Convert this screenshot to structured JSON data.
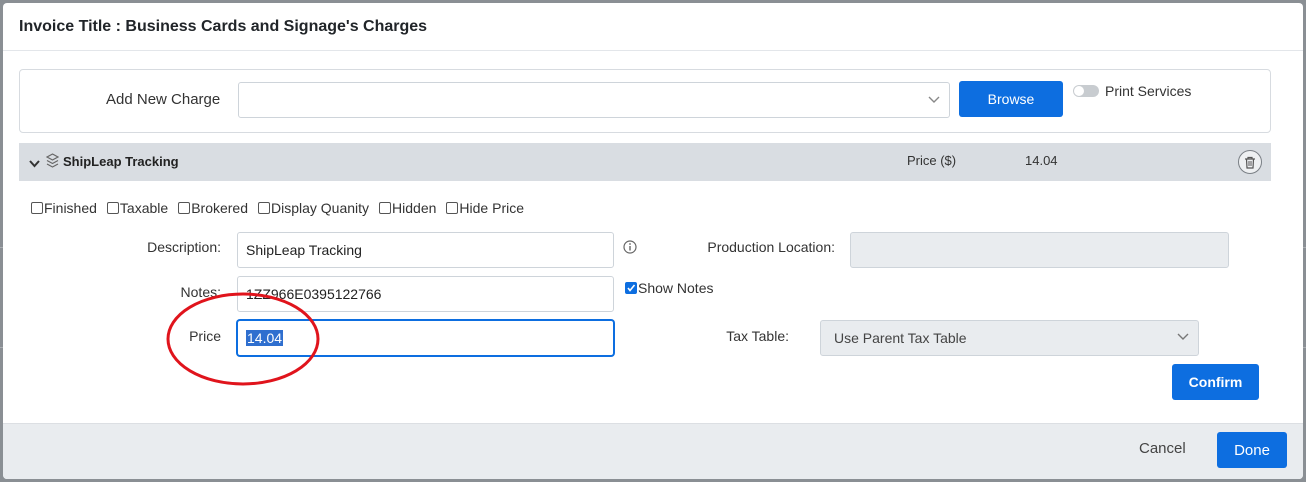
{
  "modal": {
    "title": "Invoice Title : Business Cards and Signage's Charges"
  },
  "add_charge": {
    "label": "Add New Charge",
    "select_value": "",
    "browse_label": "Browse",
    "print_services_label": "Print Services",
    "print_services_on": false
  },
  "charge_item": {
    "name": "ShipLeap Tracking",
    "price_header": "Price ($)",
    "price_value": "14.04"
  },
  "options": [
    {
      "label": "Finished",
      "checked": false
    },
    {
      "label": "Taxable",
      "checked": false
    },
    {
      "label": "Brokered",
      "checked": false
    },
    {
      "label": "Display Quanity",
      "checked": false
    },
    {
      "label": "Hidden",
      "checked": false
    },
    {
      "label": "Hide Price",
      "checked": false
    }
  ],
  "form": {
    "description_label": "Description:",
    "description_value": "ShipLeap Tracking",
    "production_location_label": "Production Location:",
    "production_location_value": "",
    "notes_label": "Notes:",
    "notes_value": "1ZZ966E0395122766",
    "show_notes_label": "Show Notes",
    "show_notes_checked": true,
    "price_label": "Price",
    "price_value": "14.04",
    "tax_table_label": "Tax Table:",
    "tax_table_value": "Use Parent Tax Table",
    "confirm_label": "Confirm"
  },
  "footer": {
    "cancel_label": "Cancel",
    "done_label": "Done"
  },
  "colors": {
    "primary": "#0d6ee0",
    "annotation": "#e0141c",
    "item_bar": "#d9dde2"
  }
}
